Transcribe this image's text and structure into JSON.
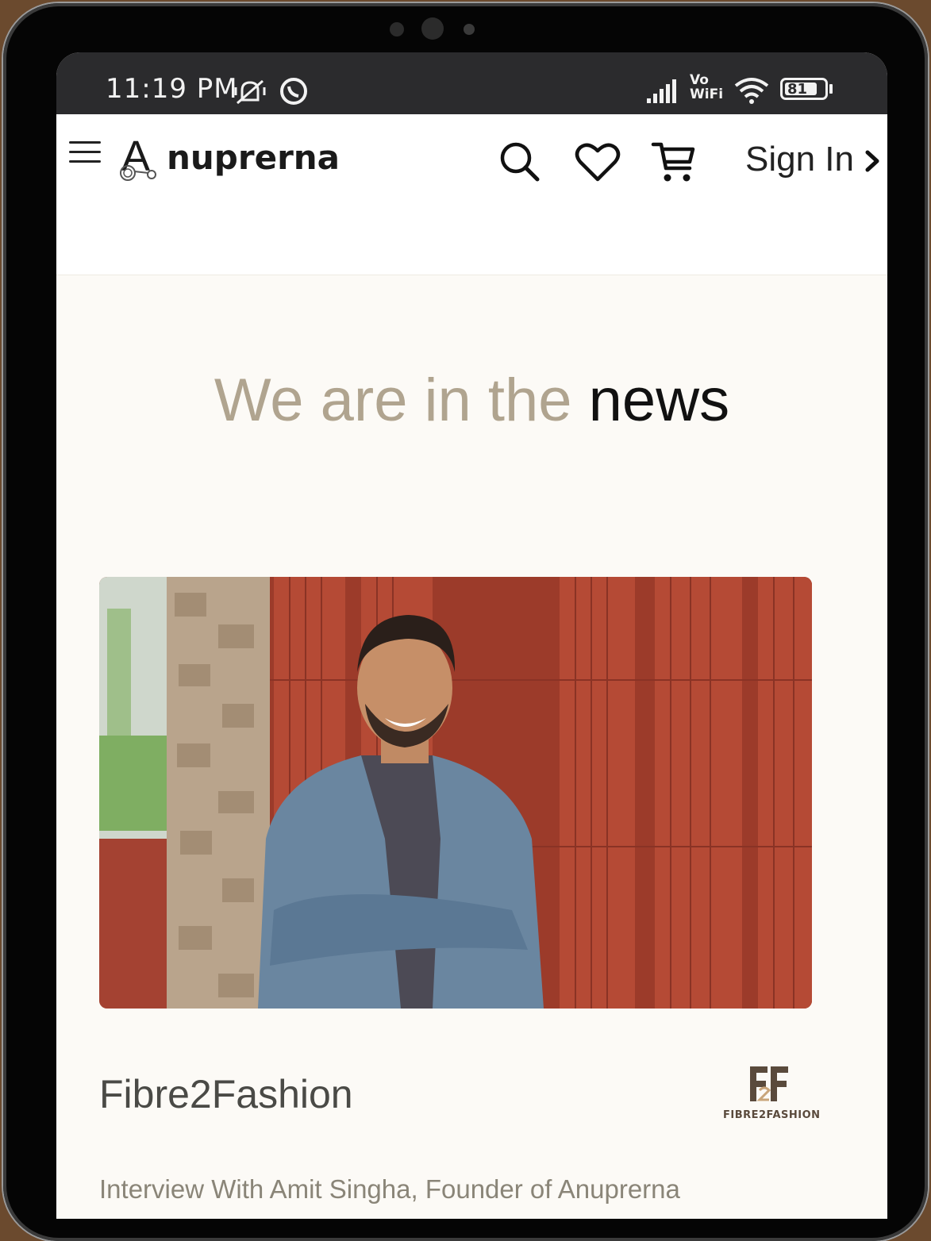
{
  "status_bar": {
    "time": "11:19 PM",
    "network_label": "Vo WiFi",
    "battery": "81"
  },
  "header": {
    "logo_text": "nuprerna",
    "logo_mark": "A",
    "sign_in_label": "Sign In",
    "icons": [
      "menu-icon",
      "search-icon",
      "heart-icon",
      "cart-icon",
      "chevron-right-icon"
    ]
  },
  "news": {
    "title_light": "We are in the ",
    "title_dark": "news",
    "press_name": "Fibre2Fashion",
    "press_logo_text": "FIBRE2FASHION",
    "press_description": "Interview With Amit Singha, Founder of Anuprerna"
  },
  "colors": {
    "title_light": "#b0a48f",
    "page_bg": "#fcfaf6",
    "status_bar_bg": "#2b2b2d"
  }
}
